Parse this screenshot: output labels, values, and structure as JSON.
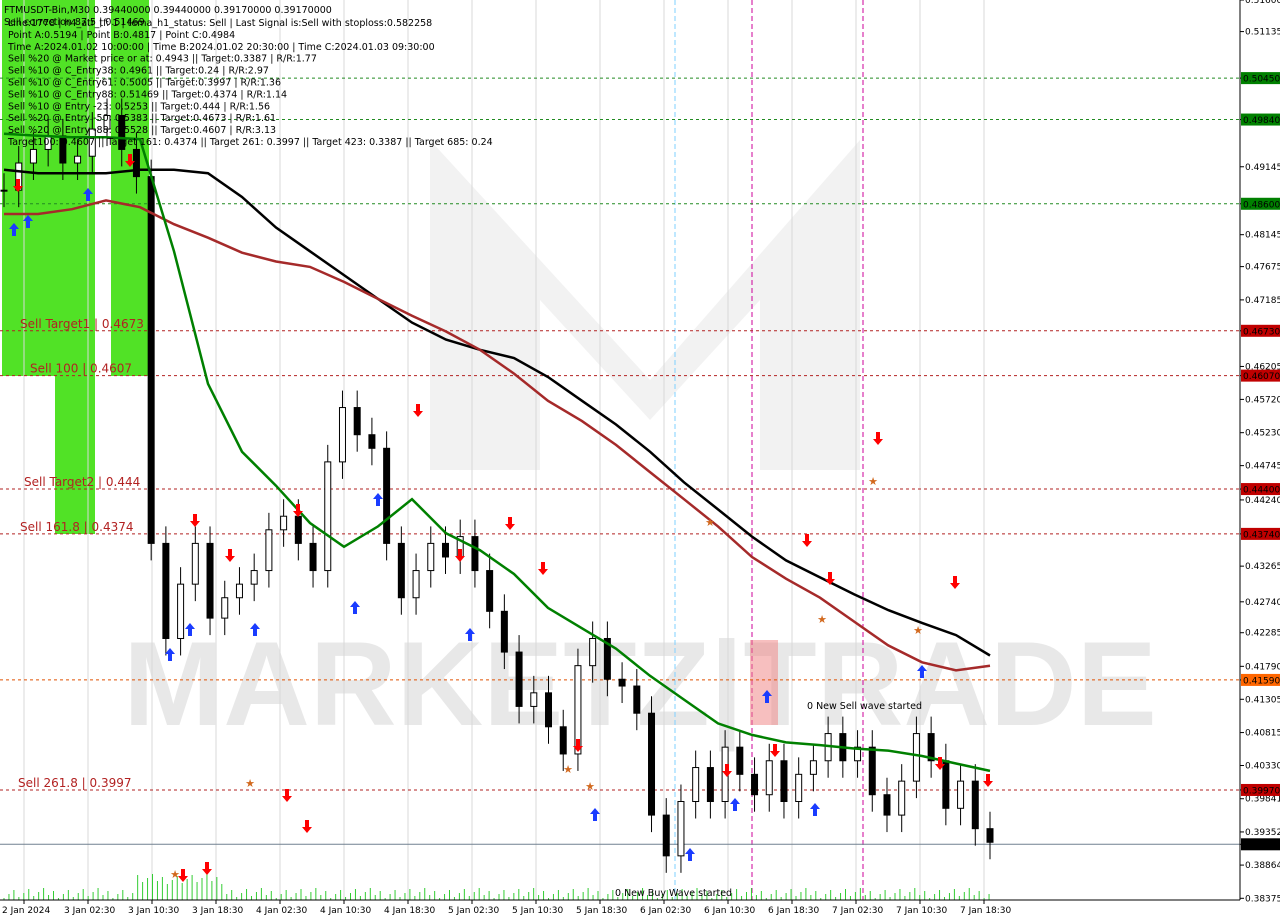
{
  "symbol_line": "FTMUSDT-Bin,M30  0.39440000 0.39440000 0.39170000 0.39170000",
  "info_lines": [
    "Line:1778 | h4_atr_tf: 1 | tema_h1_status: Sell | Last Signal is:Sell with stoploss:0.582258",
    "Point A:0.5194 | Point B:0.4817 | Point C:0.4984",
    "Time A:2024.01.02 10:00:00 | Time B:2024.01.02 20:30:00 | Time C:2024.01.03 09:30:00",
    "Sell %20 @ Market price or at: 0.4943 || Target:0.3387 | R/R:1.77",
    "Sell %10 @ C_Entry38: 0.4961 || Target:0.24 | R/R:2.97",
    "Sell %10 @ C_Entry61: 0.5005 || Target:0.3997 | R/R:1.36",
    "Sell %10 @ C_Entry88: 0.51469 || Target:0.4374 | R/R:1.14",
    "Sell %10 @ Entry -23: 0.5253 || Target:0.444 | R/R:1.56",
    "Sell %20 @ Entry -50: 0.5383 || Target:0.4673 | R/R:1.61",
    "Sell %20 @ Entry -88: 0.5528 || Target:0.4607 | R/R:3.13",
    "Target100: 0.4607 || Target 161: 0.4374 || Target 261: 0.3997 || Target 423: 0.3387 || Target 685: 0.24"
  ],
  "overlay_texts": {
    "sell_correction": "Sell correction 87.5 | 0.51469",
    "new_sell_wave": "0 New Sell wave started",
    "new_buy_wave": "0 New Buy Wave started",
    "watermark": "MARKETZ|TRADE"
  },
  "levels": [
    {
      "label": "Sell Target1 | 0.4673",
      "price": 0.4673,
      "tag": "0.46730"
    },
    {
      "label": "Sell 100 | 0.4607",
      "price": 0.4607,
      "tag": "0.46070"
    },
    {
      "label": "Sell Target2 | 0.444",
      "price": 0.444,
      "tag": "0.44400"
    },
    {
      "label": "Sell 161.8 | 0.4374",
      "price": 0.4374,
      "tag": "0.43740"
    },
    {
      "label": "Sell 261.8 | 0.3997",
      "price": 0.3997,
      "tag": "0.39970"
    }
  ],
  "green_levels": [
    {
      "price": 0.5045,
      "tag": "0.50450"
    },
    {
      "price": 0.4984,
      "tag": "0.49840"
    },
    {
      "price": 0.486,
      "tag": "0.48600"
    }
  ],
  "extra_level": {
    "price": 0.4159,
    "tag": "0.41590"
  },
  "current_price": {
    "price": 0.3917,
    "tag": "0.39170"
  },
  "colors": {
    "sell_level": "#b22222",
    "green_level": "#228b22",
    "price_tag_red": "#c00000",
    "price_tag_green": "#008000",
    "price_tag_orange": "#ff6600",
    "ma_black": "#000000",
    "ma_red": "#a52a2a",
    "ma_green": "#008000",
    "zone_green": "#33dd00",
    "vline_magenta": "#cc0099"
  },
  "chart_data": {
    "type": "line",
    "title": "FTMUSDT-Bin,M30",
    "ylim": [
      0.3835,
      0.516
    ],
    "y_ticks": [
      "0.51600",
      "0.51135",
      "0.50450",
      "0.49840",
      "0.49145",
      "0.48600",
      "0.48145",
      "0.47675",
      "0.47185",
      "0.46730",
      "0.46205",
      "0.46070",
      "0.45720",
      "0.45230",
      "0.44745",
      "0.44400",
      "0.44240",
      "0.43740",
      "0.43265",
      "0.42740",
      "0.42285",
      "0.41790",
      "0.41590",
      "0.41305",
      "0.40815",
      "0.40330",
      "0.39970",
      "0.39841",
      "0.39352",
      "0.39170",
      "0.38864",
      "0.38375"
    ],
    "x_ticks": [
      "2 Jan 2024",
      "3 Jan 02:30",
      "3 Jan 10:30",
      "3 Jan 18:30",
      "4 Jan 02:30",
      "4 Jan 10:30",
      "4 Jan 18:30",
      "5 Jan 02:30",
      "5 Jan 10:30",
      "5 Jan 18:30",
      "6 Jan 02:30",
      "6 Jan 10:30",
      "6 Jan 18:30",
      "7 Jan 02:30",
      "7 Jan 10:30",
      "7 Jan 18:30"
    ],
    "series": [
      {
        "name": "",
        "color": "#000000",
        "values": [
          0.491,
          0.4905,
          0.4905,
          0.4905,
          0.491,
          0.491,
          0.4905,
          0.487,
          0.4825,
          0.479,
          0.4755,
          0.472,
          0.4685,
          0.466,
          0.4645,
          0.4633,
          0.4605,
          0.457,
          0.4535,
          0.4495,
          0.445,
          0.441,
          0.437,
          0.4335,
          0.431,
          0.4285,
          0.4262,
          0.4243,
          0.4225,
          0.4195
        ]
      },
      {
        "name": "",
        "color": "#a52a2a",
        "values": [
          0.4845,
          0.4845,
          0.4852,
          0.4865,
          0.4855,
          0.483,
          0.481,
          0.4788,
          0.4775,
          0.4767,
          0.4745,
          0.472,
          0.4695,
          0.4672,
          0.4645,
          0.461,
          0.457,
          0.454,
          0.4505,
          0.4465,
          0.4425,
          0.4385,
          0.434,
          0.4308,
          0.428,
          0.4245,
          0.421,
          0.4185,
          0.4173,
          0.418
        ]
      },
      {
        "name": "",
        "color": "#008000",
        "values": [
          0.4963,
          0.496,
          0.4958,
          0.4958,
          0.4955,
          0.479,
          0.4595,
          0.4495,
          0.4445,
          0.439,
          0.4355,
          0.4385,
          0.4425,
          0.4375,
          0.435,
          0.4315,
          0.4265,
          0.4235,
          0.4205,
          0.4165,
          0.413,
          0.4095,
          0.4078,
          0.4067,
          0.4063,
          0.4058,
          0.4055,
          0.4047,
          0.4036,
          0.4025
        ]
      }
    ],
    "close_series": [
      0.488,
      0.492,
      0.494,
      0.496,
      0.492,
      0.493,
      0.497,
      0.499,
      0.494,
      0.49,
      0.436,
      0.422,
      0.43,
      0.436,
      0.425,
      0.428,
      0.43,
      0.432,
      0.438,
      0.44,
      0.436,
      0.432,
      0.448,
      0.456,
      0.452,
      0.45,
      0.436,
      0.428,
      0.432,
      0.436,
      0.434,
      0.437,
      0.432,
      0.426,
      0.42,
      0.412,
      0.414,
      0.409,
      0.405,
      0.418,
      0.422,
      0.416,
      0.415,
      0.411,
      0.396,
      0.39,
      0.398,
      0.403,
      0.398,
      0.406,
      0.402,
      0.399,
      0.404,
      0.398,
      0.402,
      0.404,
      0.408,
      0.404,
      0.406,
      0.399,
      0.396,
      0.401,
      0.408,
      0.404,
      0.397,
      0.401,
      0.394,
      0.392
    ]
  }
}
